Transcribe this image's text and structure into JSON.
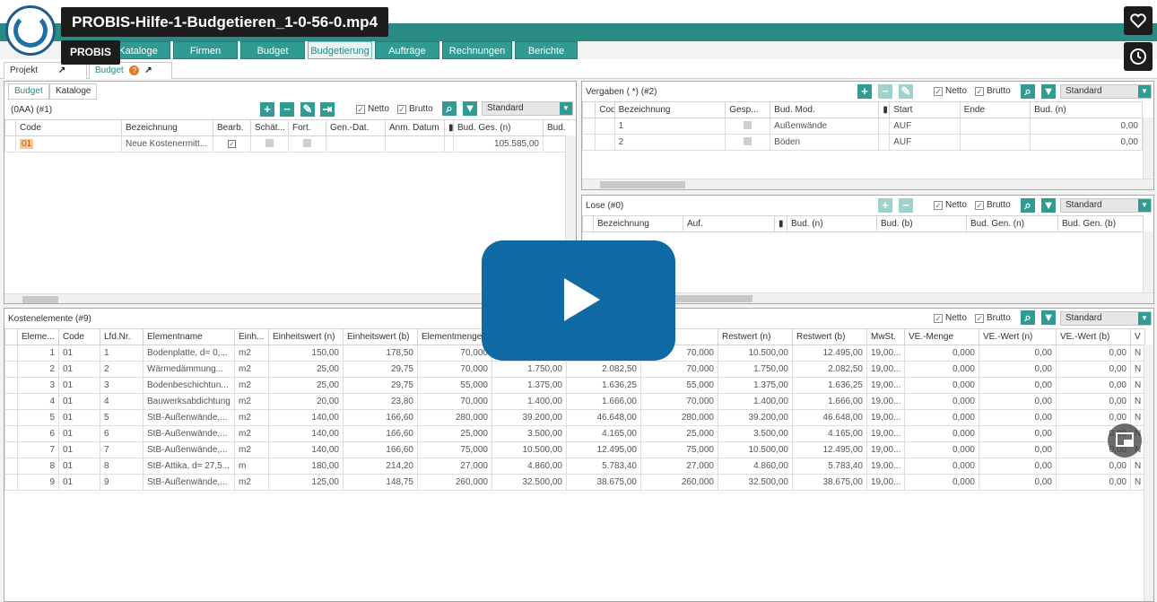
{
  "video": {
    "title": "PROBIS-Hilfe-1-Budgetieren_1-0-56-0.mp4",
    "channel": "PROBIS",
    "icons": [
      "heart-icon",
      "clock-icon",
      "play-icon",
      "picture-in-picture-icon"
    ]
  },
  "nav": {
    "items": [
      "Kataloge",
      "Firmen",
      "Budget",
      "Budgetierung",
      "Aufträge",
      "Rechnungen",
      "Berichte"
    ],
    "active": "Budgetierung"
  },
  "doc_tabs": {
    "projekt": "Projekt",
    "budget": "Budget"
  },
  "budget_panel": {
    "tabs": [
      "Budget",
      "Kataloge"
    ],
    "header": "(0AA) (#1)",
    "netto": "Netto",
    "brutto": "Brutto",
    "view": "Standard",
    "columns": [
      "Code",
      "Bezeichnung",
      "Bearb.",
      "Schät...",
      "Fort.",
      "Gen.-Dat.",
      "Anm. Datum",
      "Bud. Ges. (n)",
      "Bud."
    ],
    "rows": [
      {
        "code": "01",
        "bezeichnung": "Neue Kostenermitt...",
        "bud_ges": "105.585,00"
      }
    ]
  },
  "vergaben_panel": {
    "title": "Vergaben ( *) (#2)",
    "netto": "Netto",
    "brutto": "Brutto",
    "view": "Standard",
    "columns": [
      "Code",
      "Bezeichnung",
      "Gesp...",
      "Bud. Mod.",
      "Start",
      "Ende",
      "Bud. (n)"
    ],
    "rows": [
      {
        "code": "1",
        "bezeichnung": "Außenwände",
        "mod": "AUF",
        "bud": "0,00"
      },
      {
        "code": "2",
        "bezeichnung": "Böden",
        "mod": "AUF",
        "bud": "0,00"
      }
    ]
  },
  "lose_panel": {
    "title": "Lose  (#0)",
    "netto": "Netto",
    "brutto": "Brutto",
    "view": "Standard",
    "columns": [
      "Bezeichnung",
      "Auf.",
      "Bud. (n)",
      "Bud. (b)",
      "Bud. Gen. (n)",
      "Bud. Gen. (b)"
    ]
  },
  "kosten_panel": {
    "title": "Kostenelemente  (#9)",
    "netto": "Netto",
    "brutto": "Brutto",
    "view": "Standard",
    "columns": [
      "Eleme...",
      "Code",
      "Lfd.Nr.",
      "Elementname",
      "Einh...",
      "Einheitswert (n)",
      "Einheitswert (b)",
      "Elementmenge",
      "",
      "",
      "...enge",
      "Restwert (n)",
      "Restwert (b)",
      "MwSt.",
      "VE.-Menge",
      "VE.-Wert (n)",
      "VE.-Wert (b)",
      "V"
    ],
    "rows": [
      [
        "1",
        "01",
        "1",
        "Bodenplatte, d= 0,...",
        "m2",
        "150,00",
        "178,50",
        "70,000",
        "",
        "",
        "70,000",
        "10.500,00",
        "12.495,00",
        "19,00...",
        "0,000",
        "0,00",
        "0,00",
        "N"
      ],
      [
        "2",
        "01",
        "2",
        "Wärmedämmung...",
        "m2",
        "25,00",
        "29,75",
        "70,000",
        "1.750,00",
        "2.082,50",
        "70,000",
        "1.750,00",
        "2.082,50",
        "19,00...",
        "0,000",
        "0,00",
        "0,00",
        "N"
      ],
      [
        "3",
        "01",
        "3",
        "Bodenbeschichtun...",
        "m2",
        "25,00",
        "29,75",
        "55,000",
        "1.375,00",
        "1.636,25",
        "55,000",
        "1.375,00",
        "1.636,25",
        "19,00...",
        "0,000",
        "0,00",
        "0,00",
        "N"
      ],
      [
        "4",
        "01",
        "4",
        "Bauwerksabdichtung",
        "m2",
        "20,00",
        "23,80",
        "70,000",
        "1.400,00",
        "1.666,00",
        "70,000",
        "1.400,00",
        "1.666,00",
        "19,00...",
        "0,000",
        "0,00",
        "0,00",
        "N"
      ],
      [
        "5",
        "01",
        "5",
        "StB-Außenwände,...",
        "m2",
        "140,00",
        "166,60",
        "280,000",
        "39.200,00",
        "46.648,00",
        "280,000",
        "39.200,00",
        "46.648,00",
        "19,00...",
        "0,000",
        "0,00",
        "0,00",
        "N"
      ],
      [
        "6",
        "01",
        "6",
        "StB-Außenwände,...",
        "m2",
        "140,00",
        "166,60",
        "25,000",
        "3.500,00",
        "4.165,00",
        "25,000",
        "3.500,00",
        "4.165,00",
        "19,00...",
        "0,000",
        "0,00",
        "0,00",
        "N"
      ],
      [
        "7",
        "01",
        "7",
        "StB-Außenwände,...",
        "m2",
        "140,00",
        "166,60",
        "75,000",
        "10.500,00",
        "12.495,00",
        "75,000",
        "10.500,00",
        "12.495,00",
        "19,00...",
        "0,000",
        "0,00",
        "0,00",
        "N"
      ],
      [
        "8",
        "01",
        "8",
        "StB-Attika, d= 27,5...",
        "m",
        "180,00",
        "214,20",
        "27,000",
        "4.860,00",
        "5.783,40",
        "27,000",
        "4.860,00",
        "5.783,40",
        "19,00...",
        "0,000",
        "0,00",
        "0,00",
        "N"
      ],
      [
        "9",
        "01",
        "9",
        "StB-Außenwände,...",
        "m2",
        "125,00",
        "148,75",
        "260,000",
        "32.500,00",
        "38.675,00",
        "260,000",
        "32.500,00",
        "38.675,00",
        "19,00...",
        "0,000",
        "0,00",
        "0,00",
        "N"
      ]
    ]
  }
}
